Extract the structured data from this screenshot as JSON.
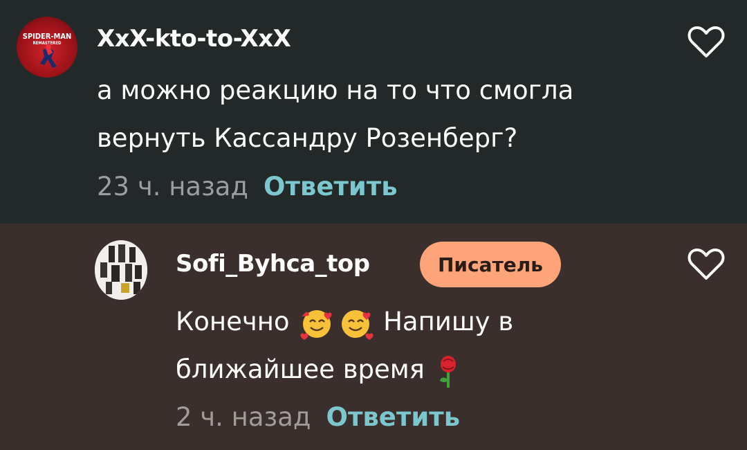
{
  "comments": [
    {
      "avatar_text_1": "SPIDER-MAN",
      "avatar_text_2": "REMASTERED",
      "username": "XxX-kto-to-XxX",
      "text_line1": "а можно реакцию на то что смогла",
      "text_line2": "вернуть Кассандру Розенберг?",
      "time": "23 ч. назад",
      "reply_label": "Ответить"
    },
    {
      "username": "Sofi_Byhca_top",
      "badge": "Писатель",
      "text_line1_a": "Конечно",
      "text_line1_b": "Напишу в",
      "text_line2": "ближайшее время",
      "time": "2 ч. назад",
      "reply_label": "Ответить"
    }
  ]
}
